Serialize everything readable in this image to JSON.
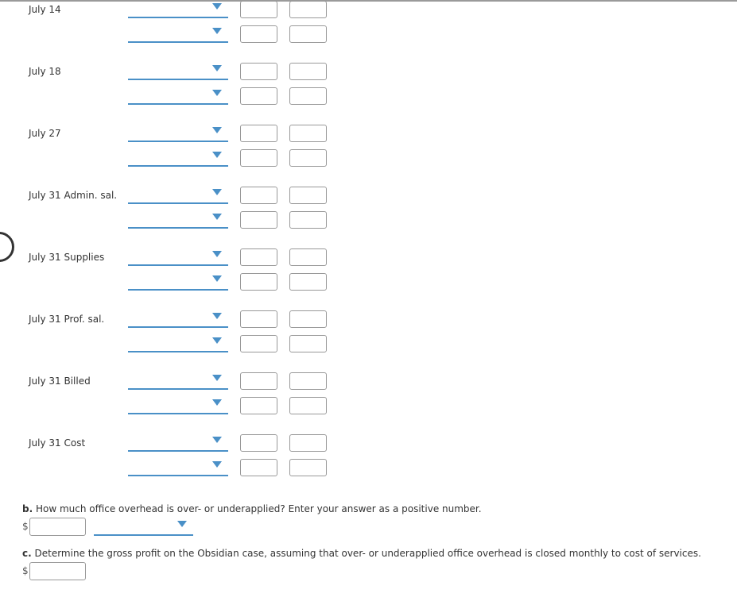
{
  "journal_entries": [
    {
      "label": "July 14"
    },
    {
      "label": "July 18"
    },
    {
      "label": "July 27"
    },
    {
      "label": "July 31 Admin. sal."
    },
    {
      "label": "July 31 Supplies"
    },
    {
      "label": "July 31 Prof. sal."
    },
    {
      "label": "July 31 Billed"
    },
    {
      "label": "July 31 Cost"
    }
  ],
  "entry_row": {
    "account_select_value": "",
    "debit_value": "",
    "credit_value": ""
  },
  "question_b": {
    "letter": "b.",
    "text": "How much office overhead is over- or underapplied? Enter your answer as a positive number.",
    "currency": "$",
    "amount_value": "",
    "over_under_select_value": ""
  },
  "question_c": {
    "letter": "c.",
    "text": "Determine the gross profit on the Obsidian case, assuming that over- or underapplied office overhead is closed monthly to cost of services.",
    "currency": "$",
    "amount_value": ""
  },
  "colors": {
    "accent": "#4a90c7",
    "input_border": "#999999"
  }
}
